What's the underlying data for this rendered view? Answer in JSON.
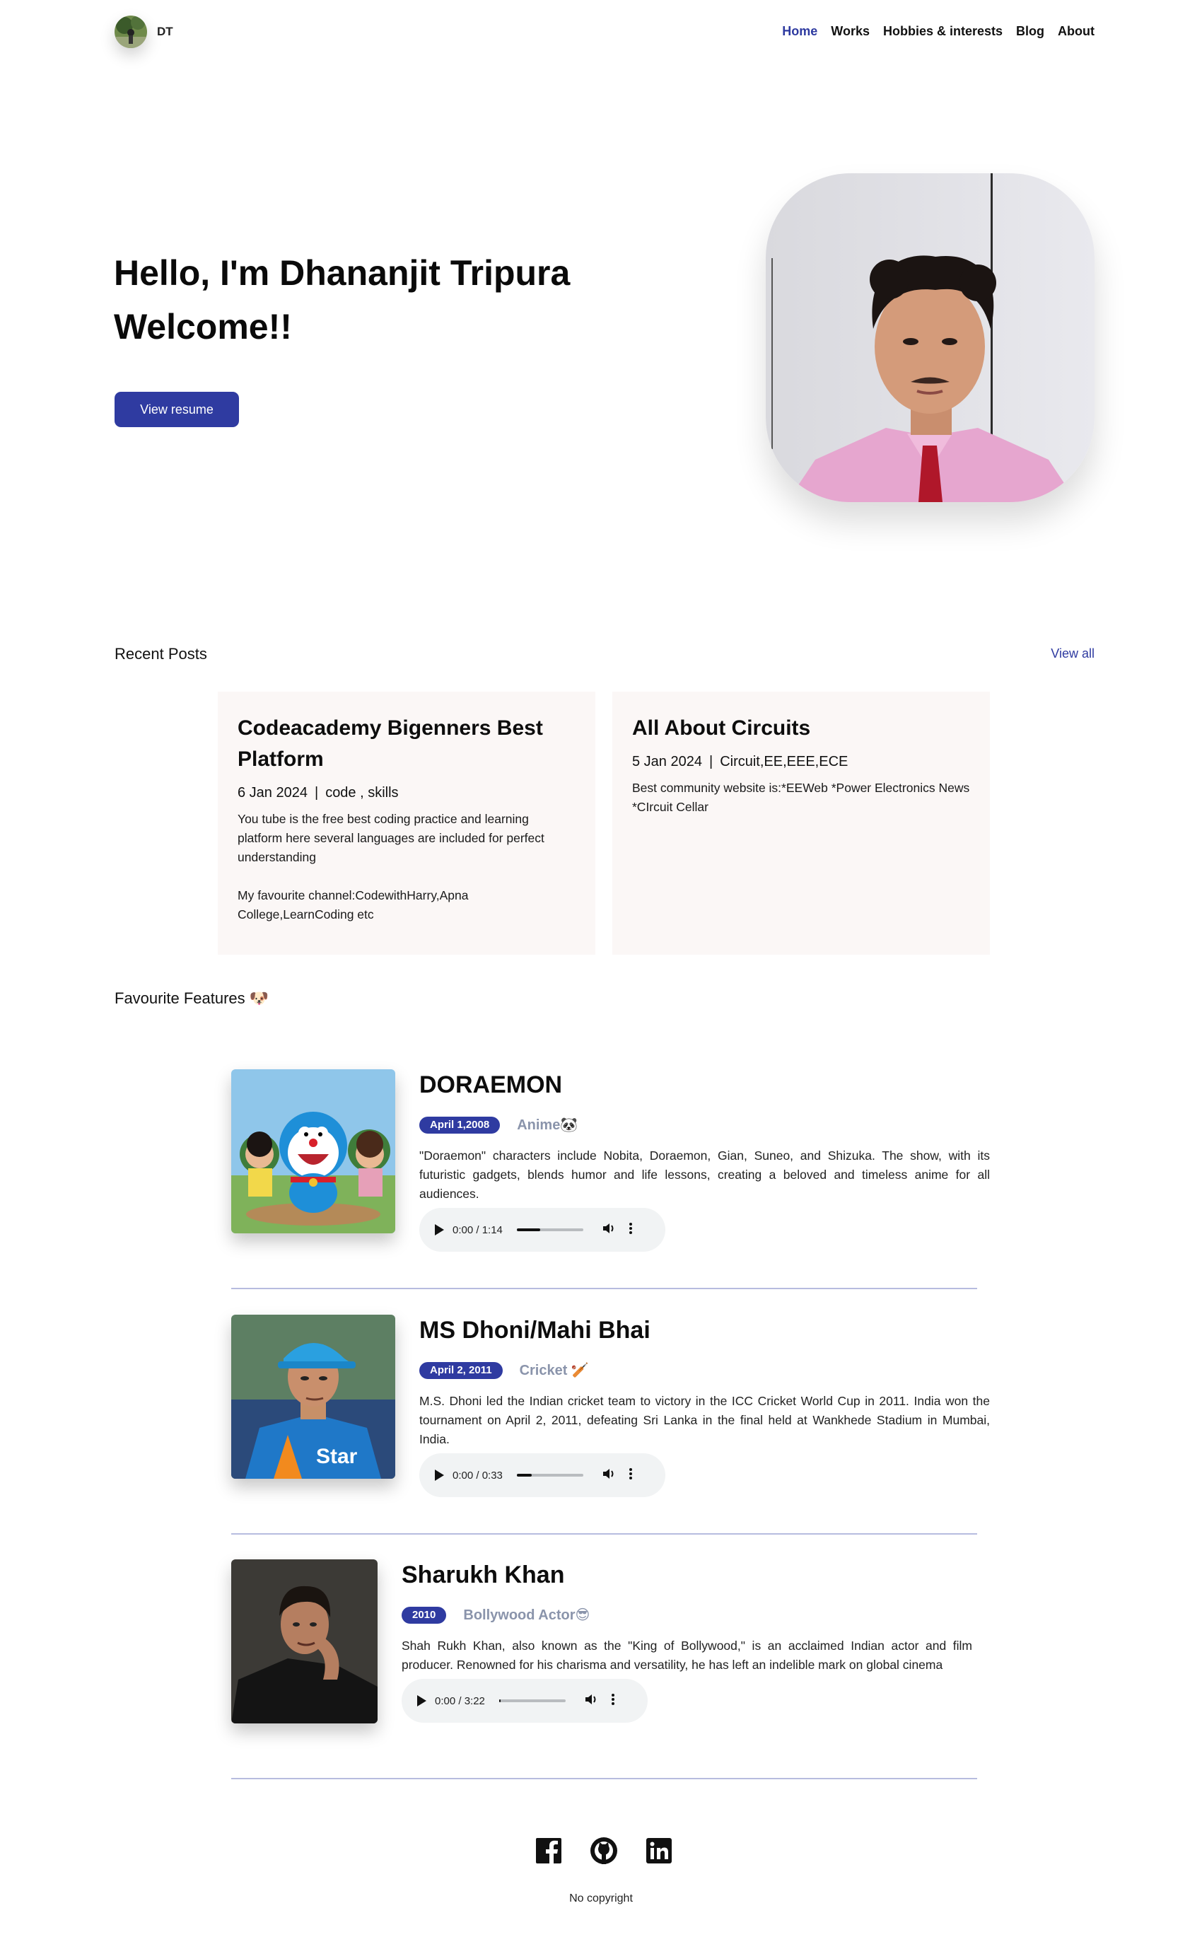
{
  "header": {
    "brand": "DT",
    "nav": [
      "Home",
      "Works",
      "Hobbies & interests",
      "Blog",
      "About"
    ],
    "active_index": 0
  },
  "hero": {
    "line1": "Hello, I'm Dhananjit Tripura",
    "line2": "Welcome!!",
    "button": "View resume"
  },
  "recent_posts": {
    "title": "Recent Posts",
    "view_all": "View all",
    "posts": [
      {
        "title": "Codeacademy Bigenners Best Platform",
        "date": "6 Jan 2024",
        "tags": "code , skills",
        "body": [
          "You tube is the free best coding practice and learning platform here several languages are included for perfect understanding",
          "My favourite channel:CodewithHarry,Apna College,LearnCoding etc"
        ]
      },
      {
        "title": "All About Circuits",
        "date": "5 Jan 2024",
        "tags": "Circuit,EE,EEE,ECE",
        "body": [
          "Best community website is:*EEWeb *Power Electronics News *CIrcuit Cellar"
        ]
      }
    ]
  },
  "features": {
    "title": "Favourite Features 🐶",
    "items": [
      {
        "title": "DORAEMON",
        "date": "April 1,2008",
        "category": "Anime🐼",
        "description": "\"Doraemon\" characters include Nobita, Doraemon, Gian, Suneo, and Shizuka. The show, with its futuristic gadgets, blends humor and life lessons, creating a beloved and timeless anime for all audiences.",
        "audio_time": "0:00 / 1:14",
        "audio_progress": 0.35
      },
      {
        "title": "MS Dhoni/Mahi Bhai",
        "date": "April 2, 2011",
        "category": "Cricket 🏏",
        "description": "M.S. Dhoni led the Indian cricket team to victory in the ICC Cricket World Cup in 2011. India won the tournament on April 2, 2011, defeating Sri Lanka in the final held at Wankhede Stadium in Mumbai, India.",
        "audio_time": "0:00 / 0:33",
        "audio_progress": 0.22
      },
      {
        "title": "Sharukh Khan",
        "date": "2010",
        "category": "Bollywood Actor😎",
        "description": "Shah Rukh Khan, also known as the \"King of Bollywood,\" is an acclaimed Indian actor and film producer. Renowned for his charisma and versatility, he has left an indelible mark on global cinema",
        "audio_time": "0:00 / 3:22",
        "audio_progress": 0.02
      }
    ]
  },
  "footer": {
    "socials": [
      "facebook-icon",
      "github-icon",
      "linkedin-icon"
    ],
    "copyright": "No copyright"
  },
  "colors": {
    "accent": "#2f3ba1",
    "card_bg": "#fbf7f6",
    "category": "#8a94ab",
    "divider": "#b7bcdf"
  }
}
